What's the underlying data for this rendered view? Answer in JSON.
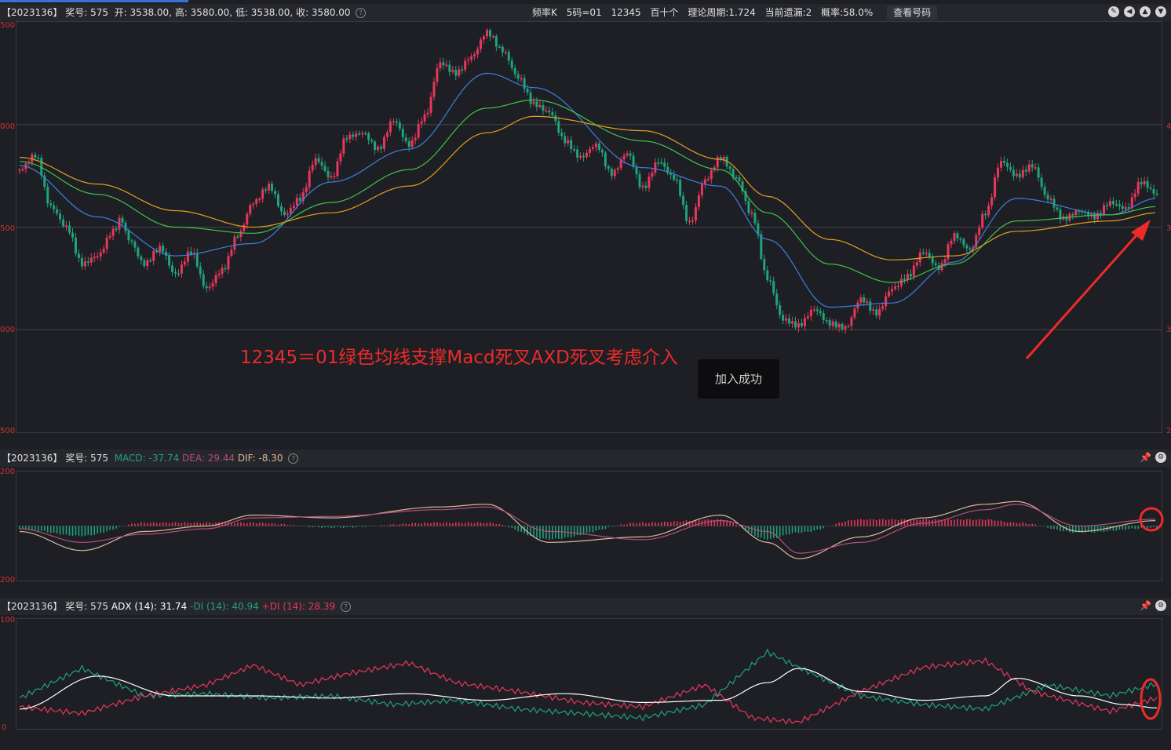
{
  "main_header": {
    "issue": "【2023136】",
    "prize_label": "奖号: 575",
    "open": "开: 3538.00,",
    "high": "高: 3580.00,",
    "low": "低: 3538.00,",
    "close": "收: 3580.00",
    "freq": "频率K",
    "code": "5码=01",
    "nums": "12345",
    "period": "百十个",
    "theory": "理论周期:1.724",
    "miss": "当前遗漏:2",
    "prob": "概率:58.0%",
    "view_btn": "查看号码"
  },
  "main_axis": {
    "top": "500",
    "l1": "000",
    "l2": "500",
    "l3": "000",
    "bottom": "500",
    "r1": "4",
    "r2": "3",
    "r3": "3",
    "r4": "2"
  },
  "annotation": "12345＝01绿色均线支撑Macd死叉AXD死叉考虑介入",
  "toast": "加入成功",
  "macd_header": {
    "issue": "【2023136】",
    "prize_label": "奖号: 575",
    "macd": "MACD: -37.74",
    "dea": "DEA: 29.44",
    "dif": "DIF: -8.30"
  },
  "macd_axis": {
    "top": "200",
    "bottom": "200"
  },
  "adx_header": {
    "issue": "【2023136】",
    "prize_label": "奖号: 575",
    "adx": "ADX (14): 31.74",
    "mdi": "-DI (14): 40.94",
    "pdi": "+DI (14): 28.39"
  },
  "adx_axis": {
    "top": "100",
    "bottom": "0"
  },
  "colors": {
    "up": "#e8365c",
    "down": "#1fa37a",
    "ma_blue": "#3d7fe0",
    "ma_green": "#3fc24a",
    "ma_orange": "#e0a020",
    "dif": "#d8b89a",
    "dea": "#b0507a",
    "adx": "#ffffff",
    "mdi": "#1fa37a",
    "pdi": "#e8365c",
    "annot": "#ee2a2a"
  },
  "chart_data": [
    {
      "type": "candlestick",
      "title": "",
      "y_ticks": [
        3000,
        3500,
        4000,
        4500
      ],
      "close_points": [
        [
          0,
          3780
        ],
        [
          10,
          3850
        ],
        [
          20,
          3600
        ],
        [
          30,
          3500
        ],
        [
          40,
          3320
        ],
        [
          50,
          3360
        ],
        [
          60,
          3480
        ],
        [
          65,
          3540
        ],
        [
          70,
          3440
        ],
        [
          80,
          3320
        ],
        [
          90,
          3400
        ],
        [
          100,
          3270
        ],
        [
          110,
          3380
        ],
        [
          120,
          3200
        ],
        [
          130,
          3290
        ],
        [
          140,
          3460
        ],
        [
          150,
          3620
        ],
        [
          160,
          3700
        ],
        [
          170,
          3560
        ],
        [
          180,
          3640
        ],
        [
          190,
          3830
        ],
        [
          200,
          3740
        ],
        [
          210,
          3940
        ],
        [
          220,
          3960
        ],
        [
          230,
          3880
        ],
        [
          240,
          4020
        ],
        [
          250,
          3900
        ],
        [
          260,
          4040
        ],
        [
          270,
          4300
        ],
        [
          280,
          4250
        ],
        [
          290,
          4330
        ],
        [
          300,
          4450
        ],
        [
          310,
          4360
        ],
        [
          320,
          4230
        ],
        [
          330,
          4100
        ],
        [
          340,
          4060
        ],
        [
          350,
          3920
        ],
        [
          360,
          3840
        ],
        [
          370,
          3900
        ],
        [
          380,
          3760
        ],
        [
          390,
          3860
        ],
        [
          400,
          3690
        ],
        [
          410,
          3820
        ],
        [
          420,
          3740
        ],
        [
          430,
          3520
        ],
        [
          440,
          3730
        ],
        [
          450,
          3840
        ],
        [
          460,
          3740
        ],
        [
          470,
          3560
        ],
        [
          480,
          3250
        ],
        [
          490,
          3050
        ],
        [
          500,
          3020
        ],
        [
          510,
          3100
        ],
        [
          520,
          3030
        ],
        [
          530,
          3010
        ],
        [
          540,
          3150
        ],
        [
          550,
          3080
        ],
        [
          560,
          3200
        ],
        [
          570,
          3260
        ],
        [
          580,
          3380
        ],
        [
          590,
          3300
        ],
        [
          600,
          3460
        ],
        [
          610,
          3390
        ],
        [
          620,
          3570
        ],
        [
          630,
          3820
        ],
        [
          640,
          3750
        ],
        [
          650,
          3800
        ],
        [
          660,
          3640
        ],
        [
          670,
          3540
        ],
        [
          680,
          3580
        ],
        [
          690,
          3550
        ],
        [
          700,
          3620
        ],
        [
          710,
          3590
        ],
        [
          720,
          3720
        ],
        [
          730,
          3660
        ]
      ],
      "series": [
        {
          "name": "",
          "values": [
            [
              0,
              3800
            ],
            [
              50,
              3550
            ],
            [
              100,
              3360
            ],
            [
              150,
              3420
            ],
            [
              200,
              3720
            ],
            [
              250,
              3880
            ],
            [
              300,
              4250
            ],
            [
              330,
              4180
            ],
            [
              400,
              3790
            ],
            [
              450,
              3700
            ],
            [
              480,
              3440
            ],
            [
              520,
              3110
            ],
            [
              560,
              3130
            ],
            [
              600,
              3330
            ],
            [
              640,
              3640
            ],
            [
              700,
              3560
            ],
            [
              730,
              3640
            ]
          ]
        },
        {
          "name": "",
          "values": [
            [
              0,
              3820
            ],
            [
              50,
              3660
            ],
            [
              100,
              3500
            ],
            [
              150,
              3470
            ],
            [
              200,
              3620
            ],
            [
              250,
              3780
            ],
            [
              300,
              4080
            ],
            [
              330,
              4120
            ],
            [
              400,
              3920
            ],
            [
              450,
              3780
            ],
            [
              480,
              3570
            ],
            [
              520,
              3320
            ],
            [
              560,
              3230
            ],
            [
              600,
              3320
            ],
            [
              640,
              3530
            ],
            [
              700,
              3560
            ],
            [
              730,
              3600
            ]
          ]
        },
        {
          "name": "",
          "values": [
            [
              0,
              3840
            ],
            [
              50,
              3710
            ],
            [
              100,
              3580
            ],
            [
              150,
              3500
            ],
            [
              200,
              3570
            ],
            [
              250,
              3700
            ],
            [
              300,
              3960
            ],
            [
              330,
              4040
            ],
            [
              400,
              3970
            ],
            [
              450,
              3830
            ],
            [
              480,
              3650
            ],
            [
              520,
              3440
            ],
            [
              560,
              3340
            ],
            [
              600,
              3360
            ],
            [
              640,
              3480
            ],
            [
              700,
              3530
            ],
            [
              730,
              3570
            ]
          ]
        }
      ]
    },
    {
      "type": "bar+line",
      "title": "MACD",
      "dif": [
        [
          0,
          -20
        ],
        [
          40,
          -90
        ],
        [
          80,
          -20
        ],
        [
          120,
          0
        ],
        [
          150,
          40
        ],
        [
          200,
          30
        ],
        [
          270,
          70
        ],
        [
          300,
          80
        ],
        [
          340,
          -60
        ],
        [
          400,
          -40
        ],
        [
          450,
          40
        ],
        [
          480,
          -60
        ],
        [
          500,
          -120
        ],
        [
          540,
          -40
        ],
        [
          580,
          30
        ],
        [
          620,
          80
        ],
        [
          640,
          90
        ],
        [
          680,
          -20
        ],
        [
          730,
          20
        ]
      ],
      "dea": [
        [
          0,
          -10
        ],
        [
          40,
          -60
        ],
        [
          80,
          -30
        ],
        [
          120,
          -10
        ],
        [
          150,
          30
        ],
        [
          200,
          35
        ],
        [
          270,
          60
        ],
        [
          300,
          70
        ],
        [
          340,
          -20
        ],
        [
          400,
          -50
        ],
        [
          450,
          20
        ],
        [
          480,
          -20
        ],
        [
          500,
          -100
        ],
        [
          540,
          -60
        ],
        [
          580,
          10
        ],
        [
          620,
          60
        ],
        [
          640,
          80
        ],
        [
          680,
          0
        ],
        [
          730,
          25
        ]
      ]
    },
    {
      "type": "line",
      "title": "ADX (14)",
      "ylim": [
        0,
        100
      ],
      "adx": [
        [
          0,
          18
        ],
        [
          50,
          48
        ],
        [
          100,
          30
        ],
        [
          150,
          30
        ],
        [
          200,
          28
        ],
        [
          250,
          32
        ],
        [
          300,
          26
        ],
        [
          350,
          32
        ],
        [
          400,
          24
        ],
        [
          450,
          26
        ],
        [
          480,
          42
        ],
        [
          500,
          55
        ],
        [
          540,
          34
        ],
        [
          580,
          26
        ],
        [
          620,
          30
        ],
        [
          640,
          46
        ],
        [
          680,
          30
        ],
        [
          710,
          22
        ],
        [
          730,
          19
        ]
      ],
      "mdi": [
        [
          0,
          28
        ],
        [
          40,
          55
        ],
        [
          80,
          30
        ],
        [
          120,
          32
        ],
        [
          160,
          28
        ],
        [
          200,
          30
        ],
        [
          240,
          22
        ],
        [
          280,
          26
        ],
        [
          320,
          18
        ],
        [
          360,
          14
        ],
        [
          400,
          10
        ],
        [
          440,
          22
        ],
        [
          480,
          70
        ],
        [
          500,
          56
        ],
        [
          540,
          30
        ],
        [
          580,
          22
        ],
        [
          620,
          18
        ],
        [
          660,
          40
        ],
        [
          700,
          30
        ],
        [
          730,
          41
        ]
      ],
      "pdi": [
        [
          0,
          20
        ],
        [
          40,
          14
        ],
        [
          80,
          30
        ],
        [
          120,
          40
        ],
        [
          150,
          58
        ],
        [
          180,
          40
        ],
        [
          210,
          50
        ],
        [
          250,
          60
        ],
        [
          280,
          42
        ],
        [
          320,
          34
        ],
        [
          360,
          24
        ],
        [
          400,
          20
        ],
        [
          440,
          40
        ],
        [
          470,
          10
        ],
        [
          500,
          6
        ],
        [
          540,
          34
        ],
        [
          580,
          56
        ],
        [
          620,
          62
        ],
        [
          650,
          34
        ],
        [
          700,
          16
        ],
        [
          730,
          28
        ]
      ]
    }
  ]
}
